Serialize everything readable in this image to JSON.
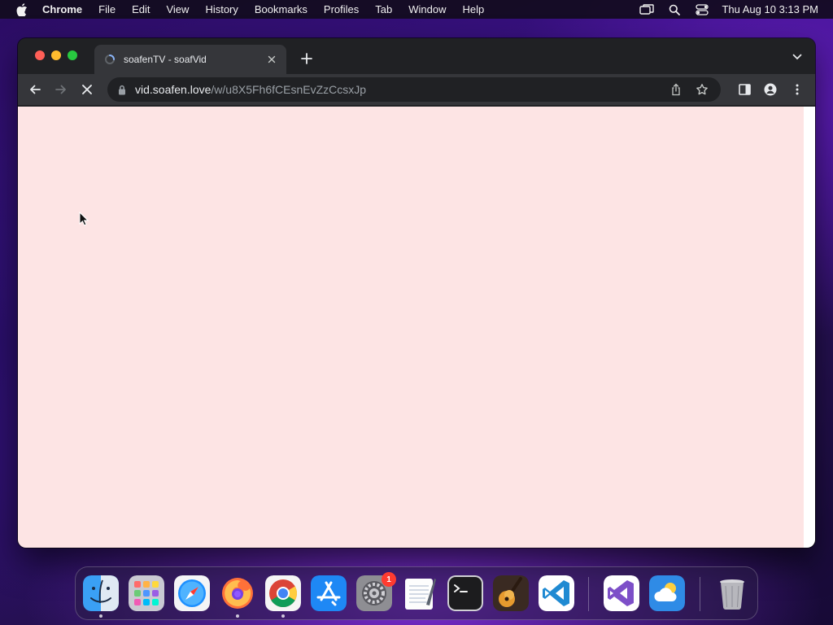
{
  "menubar": {
    "app_name": "Chrome",
    "menus": [
      "File",
      "Edit",
      "View",
      "History",
      "Bookmarks",
      "Profiles",
      "Tab",
      "Window",
      "Help"
    ],
    "clock": "Thu Aug 10  3:13 PM"
  },
  "browser": {
    "tab": {
      "title": "soafenTV - soafVid",
      "favicon": "soafvid-favicon"
    },
    "address": {
      "host": "vid.soafen.love",
      "path": "/w/u8X5Fh6fCEsnEvZzCcsxJp"
    },
    "state": "loading",
    "page_background": "#fde4e4"
  },
  "dock": {
    "apps": [
      {
        "name": "Finder",
        "icon": "finder-icon",
        "running": true
      },
      {
        "name": "Launchpad",
        "icon": "launchpad-icon",
        "running": false
      },
      {
        "name": "Safari",
        "icon": "safari-icon",
        "running": false
      },
      {
        "name": "Firefox",
        "icon": "firefox-icon",
        "running": true
      },
      {
        "name": "Google Chrome",
        "icon": "chrome-icon",
        "running": true
      },
      {
        "name": "App Store",
        "icon": "app-store-icon",
        "running": false
      },
      {
        "name": "System Preferences",
        "icon": "system-preferences-icon",
        "running": false,
        "badge": "1"
      },
      {
        "name": "TextEdit",
        "icon": "textedit-icon",
        "running": false
      },
      {
        "name": "Terminal",
        "icon": "terminal-icon",
        "running": false
      },
      {
        "name": "GarageBand",
        "icon": "garageband-icon",
        "running": false
      },
      {
        "name": "Visual Studio Code",
        "icon": "vscode-icon",
        "running": false
      },
      {
        "name": "Visual Studio",
        "icon": "visual-studio-icon",
        "running": false
      },
      {
        "name": "Weather",
        "icon": "weather-icon",
        "running": false
      },
      {
        "name": "Trash",
        "icon": "trash-icon",
        "running": false
      }
    ]
  }
}
